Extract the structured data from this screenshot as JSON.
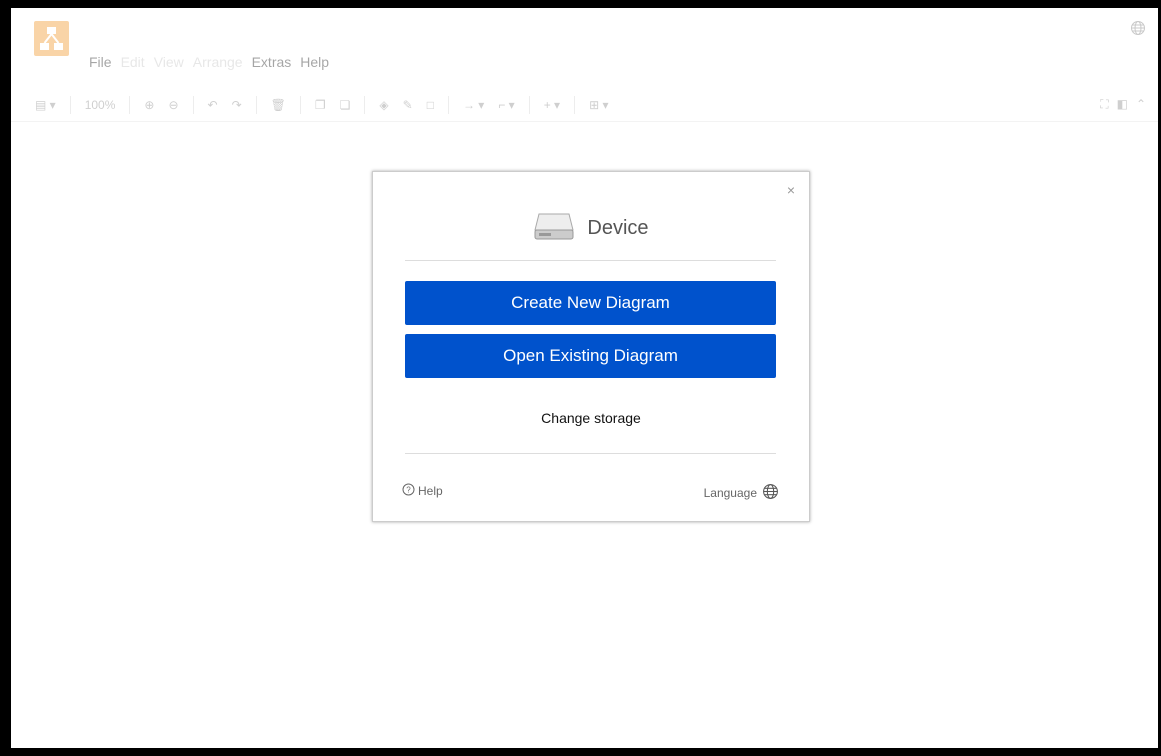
{
  "menu": {
    "items": [
      "File",
      "Edit",
      "View",
      "Arrange",
      "Extras",
      "Help"
    ]
  },
  "toolbar": {
    "zoom": "100%"
  },
  "dialog": {
    "title": "Device",
    "create_label": "Create New Diagram",
    "open_label": "Open Existing Diagram",
    "change_storage": "Change storage",
    "help_label": "Help",
    "language_label": "Language",
    "close_symbol": "×"
  },
  "colors": {
    "primary": "#0052cc",
    "logo": "#f08705"
  }
}
